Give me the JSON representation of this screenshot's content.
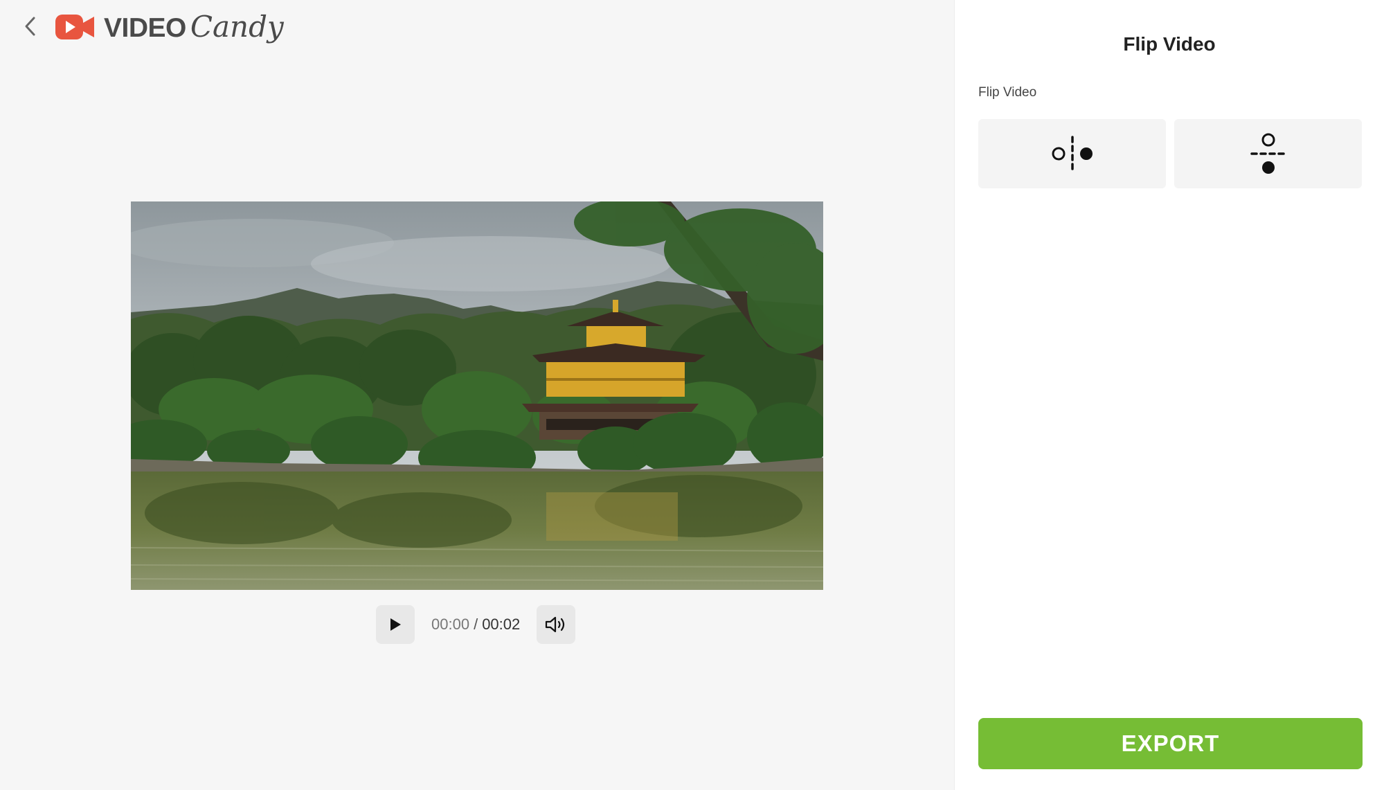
{
  "header": {
    "back_icon": "chevron-left-icon",
    "logo": {
      "icon": "video-camera-icon",
      "brand_color": "#e8553f",
      "word_video": "VIDEO",
      "word_candy": "Candy"
    }
  },
  "player": {
    "current_time": "00:00",
    "separator": "/",
    "total_time": "00:02",
    "play_icon": "play-icon",
    "volume_icon": "volume-icon"
  },
  "panel": {
    "title": "Flip Video",
    "section_label": "Flip Video",
    "options": [
      {
        "icon": "flip-horizontal-icon"
      },
      {
        "icon": "flip-vertical-icon"
      }
    ],
    "export_label": "EXPORT",
    "export_color": "#76bd35"
  }
}
